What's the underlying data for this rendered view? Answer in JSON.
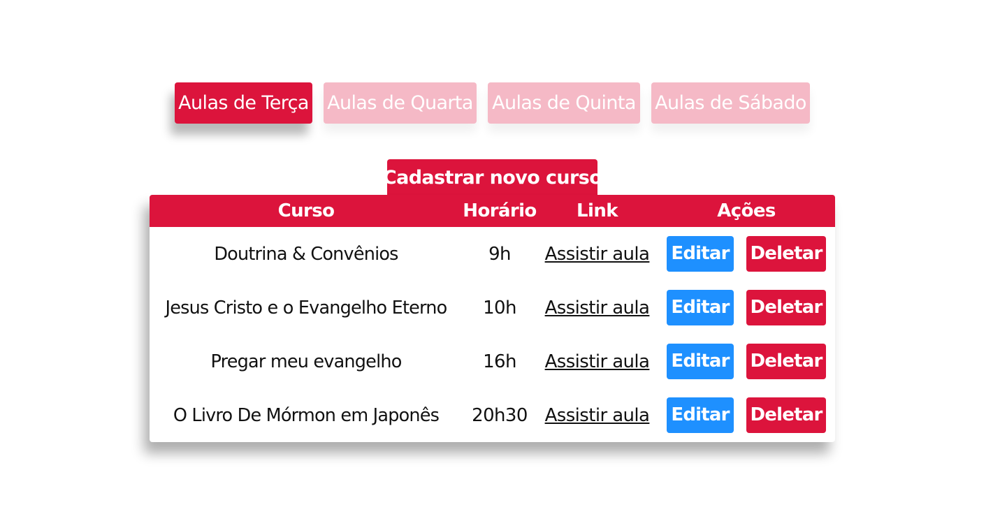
{
  "tabs": [
    {
      "label": "Aulas de Terça",
      "active": true
    },
    {
      "label": "Aulas de Quarta",
      "active": false
    },
    {
      "label": "Aulas de Quinta",
      "active": false
    },
    {
      "label": "Aulas de Sábado",
      "active": false
    }
  ],
  "new_course_label": "Cadastrar novo curso",
  "table": {
    "headers": {
      "course": "Curso",
      "time": "Horário",
      "link": "Link",
      "actions": "Ações"
    },
    "rows": [
      {
        "course": "Doutrina & Convênios",
        "time": "9h",
        "link": "Assistir aula",
        "edit": "Editar",
        "delete": "Deletar"
      },
      {
        "course": "Jesus Cristo e o Evangelho Eterno",
        "time": "10h",
        "link": "Assistir aula",
        "edit": "Editar",
        "delete": "Deletar"
      },
      {
        "course": "Pregar meu evangelho",
        "time": "16h",
        "link": "Assistir aula",
        "edit": "Editar",
        "delete": "Deletar"
      },
      {
        "course": "O Livro De Mórmon em Japonês",
        "time": "20h30",
        "link": "Assistir aula",
        "edit": "Editar",
        "delete": "Deletar"
      }
    ]
  },
  "colors": {
    "primary": "#dc143c",
    "primary_light": "#f5b9c6",
    "edit": "#1e90ff"
  }
}
